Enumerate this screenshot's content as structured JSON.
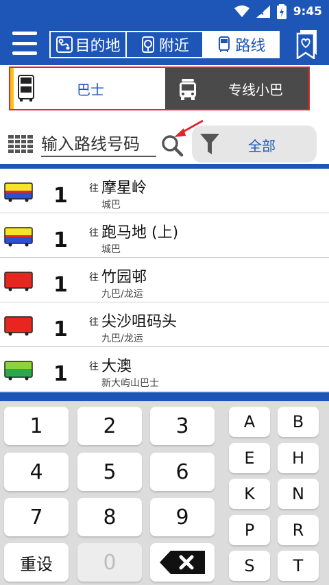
{
  "status": {
    "time": "9:45",
    "battery_level": "9"
  },
  "nav": {
    "tabs": [
      {
        "label": "目的地",
        "icon": "route-icon"
      },
      {
        "label": "附近",
        "icon": "nearby-icon"
      },
      {
        "label": "路线",
        "icon": "bus-stop-icon"
      }
    ],
    "active_tab": "路线"
  },
  "vehicle_tabs": {
    "bus_label": "巴士",
    "minibus_label": "专线小巴"
  },
  "search": {
    "placeholder": "输入路线号码",
    "filter_label": "全部"
  },
  "routes": [
    {
      "number": "1",
      "to": "往",
      "destination": "摩星岭",
      "operator": "城巴",
      "color_top": "#f8e32b",
      "color_bottom": "#2a52d1",
      "stripe": "#e8251e"
    },
    {
      "number": "1",
      "to": "往",
      "destination": "跑马地 (上)",
      "operator": "城巴",
      "color_top": "#f8e32b",
      "color_bottom": "#2a52d1",
      "stripe": "#e8251e"
    },
    {
      "number": "1",
      "to": "往",
      "destination": "竹园邨",
      "operator": "九巴/龙运",
      "color_top": "#e8251e",
      "color_bottom": "#e8251e",
      "stripe": "#e8251e"
    },
    {
      "number": "1",
      "to": "往",
      "destination": "尖沙咀码头",
      "operator": "九巴/龙运",
      "color_top": "#e8251e",
      "color_bottom": "#e8251e",
      "stripe": "#e8251e"
    },
    {
      "number": "1",
      "to": "往",
      "destination": "大澳",
      "operator": "新大屿山巴士",
      "color_top": "#8dd43a",
      "color_bottom": "#2aa84a",
      "stripe": "#2aa84a"
    }
  ],
  "keypad": {
    "numbers": [
      "1",
      "2",
      "3",
      "4",
      "5",
      "6",
      "7",
      "8",
      "9"
    ],
    "reset_label": "重设",
    "zero_label": "0",
    "letters": [
      "A",
      "B",
      "E",
      "H",
      "K",
      "N",
      "P",
      "R",
      "S",
      "T"
    ]
  },
  "colors": {
    "primary": "#1e56b8",
    "accent_red": "#e0252b",
    "tab_indicator": "#f7c21b"
  }
}
